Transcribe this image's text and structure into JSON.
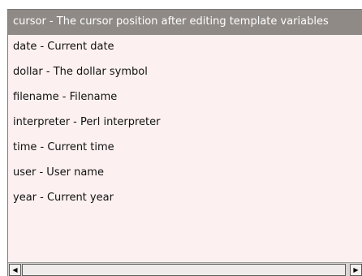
{
  "list": {
    "items": [
      "cursor - The cursor position after editing template variables",
      "date - Current date",
      "dollar - The dollar symbol",
      "filename - Filename",
      "interpreter - Perl interpreter",
      "time - Current time",
      "user - User name",
      "year - Current year"
    ],
    "selected_index": 0
  },
  "scrollbar": {
    "left_arrow_icon": "triangle-left-icon",
    "right_arrow_icon": "triangle-right-icon"
  },
  "colors": {
    "list_background": "#fcf1f0",
    "selected_background": "#8f8a86",
    "selected_text": "#ffffff"
  }
}
